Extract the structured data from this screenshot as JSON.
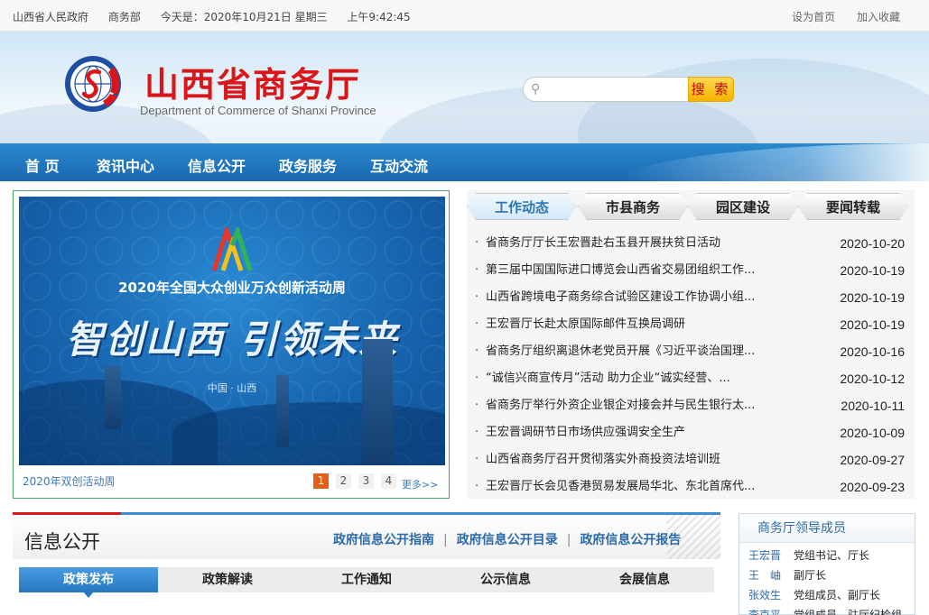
{
  "topbar": {
    "gov_link": "山西省人民政府",
    "mofcom_link": "商务部",
    "date_text": "今天是：2020年10月21日 星期三",
    "time_text": "上午9:42:45",
    "set_home": "设为首页",
    "add_favorite": "加入收藏"
  },
  "header": {
    "title": "山西省商务厅",
    "subtitle": "Department of Commerce of Shanxi Province",
    "search_placeholder": "",
    "search_button": "搜 索"
  },
  "nav": [
    "首 页",
    "资讯中心",
    "信息公开",
    "政务服务",
    "互动交流"
  ],
  "slider": {
    "image_line1": "2020年全国大众创业万众创新活动周",
    "image_line2": "智创山西  引领未来",
    "image_line3": "中国 · 山西",
    "caption": "2020年双创活动周",
    "pages": [
      "1",
      "2",
      "3",
      "4"
    ],
    "active_page": "1",
    "more": "更多>>"
  },
  "news": {
    "tabs": [
      "工作动态",
      "市县商务",
      "园区建设",
      "要闻转载"
    ],
    "active_tab": "工作动态",
    "items": [
      {
        "title": "省商务厅厅长王宏晋赴右玉县开展扶贫日活动",
        "date": "2020-10-20"
      },
      {
        "title": "第三届中国国际进口博览会山西省交易团组织工作...",
        "date": "2020-10-19"
      },
      {
        "title": "山西省跨境电子商务综合试验区建设工作协调小组...",
        "date": "2020-10-19"
      },
      {
        "title": "王宏晋厅长赴太原国际邮件互换局调研",
        "date": "2020-10-19"
      },
      {
        "title": "省商务厅组织离退休老党员开展《习近平谈治国理...",
        "date": "2020-10-16"
      },
      {
        "title": "“诚信兴商宣传月”活动 助力企业“诚实经营、...",
        "date": "2020-10-12"
      },
      {
        "title": "省商务厅举行外资企业银企对接会并与民生银行太...",
        "date": "2020-10-11"
      },
      {
        "title": "王宏晋调研节日市场供应强调安全生产",
        "date": "2020-10-09"
      },
      {
        "title": "山西省商务厅召开贯彻落实外商投资法培训班",
        "date": "2020-09-27"
      },
      {
        "title": "王宏晋厅长会见香港贸易发展局华北、东北首席代...",
        "date": "2020-09-23"
      }
    ]
  },
  "info": {
    "title": "信息公开",
    "links": [
      "政府信息公开指南",
      "政府信息公开目录",
      "政府信息公开报告"
    ],
    "subtabs": [
      "政策发布",
      "政策解读",
      "工作通知",
      "公示信息",
      "会展信息"
    ],
    "active_subtab": "政策发布"
  },
  "leaders": {
    "title": "商务厅领导成员",
    "rows": [
      {
        "name": "王宏晋",
        "post": "党组书记、厅长"
      },
      {
        "name": "王　岫",
        "post": "副厅长"
      },
      {
        "name": "张效生",
        "post": "党组成员、副厅长"
      },
      {
        "name": "李克平",
        "post": "党组成员、驻厅纪检组"
      }
    ]
  },
  "colors": {
    "brand_red": "#d9171b",
    "nav_blue": "#1f74bd",
    "link_blue": "#2b6aa8",
    "pager_active": "#e55e15",
    "search_button": "#f5b300"
  }
}
